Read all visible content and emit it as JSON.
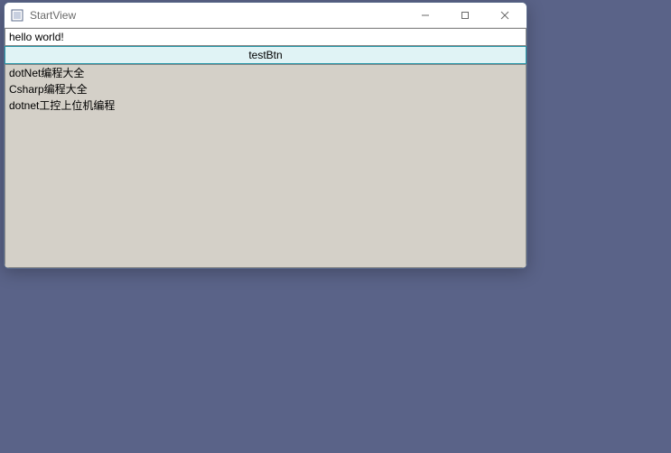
{
  "window": {
    "title": "StartView"
  },
  "textbox": {
    "value": "hello world!"
  },
  "button": {
    "label": "testBtn"
  },
  "list": {
    "items": [
      "dotNet编程大全",
      "Csharp编程大全",
      "dotnet工控上位机编程"
    ]
  }
}
